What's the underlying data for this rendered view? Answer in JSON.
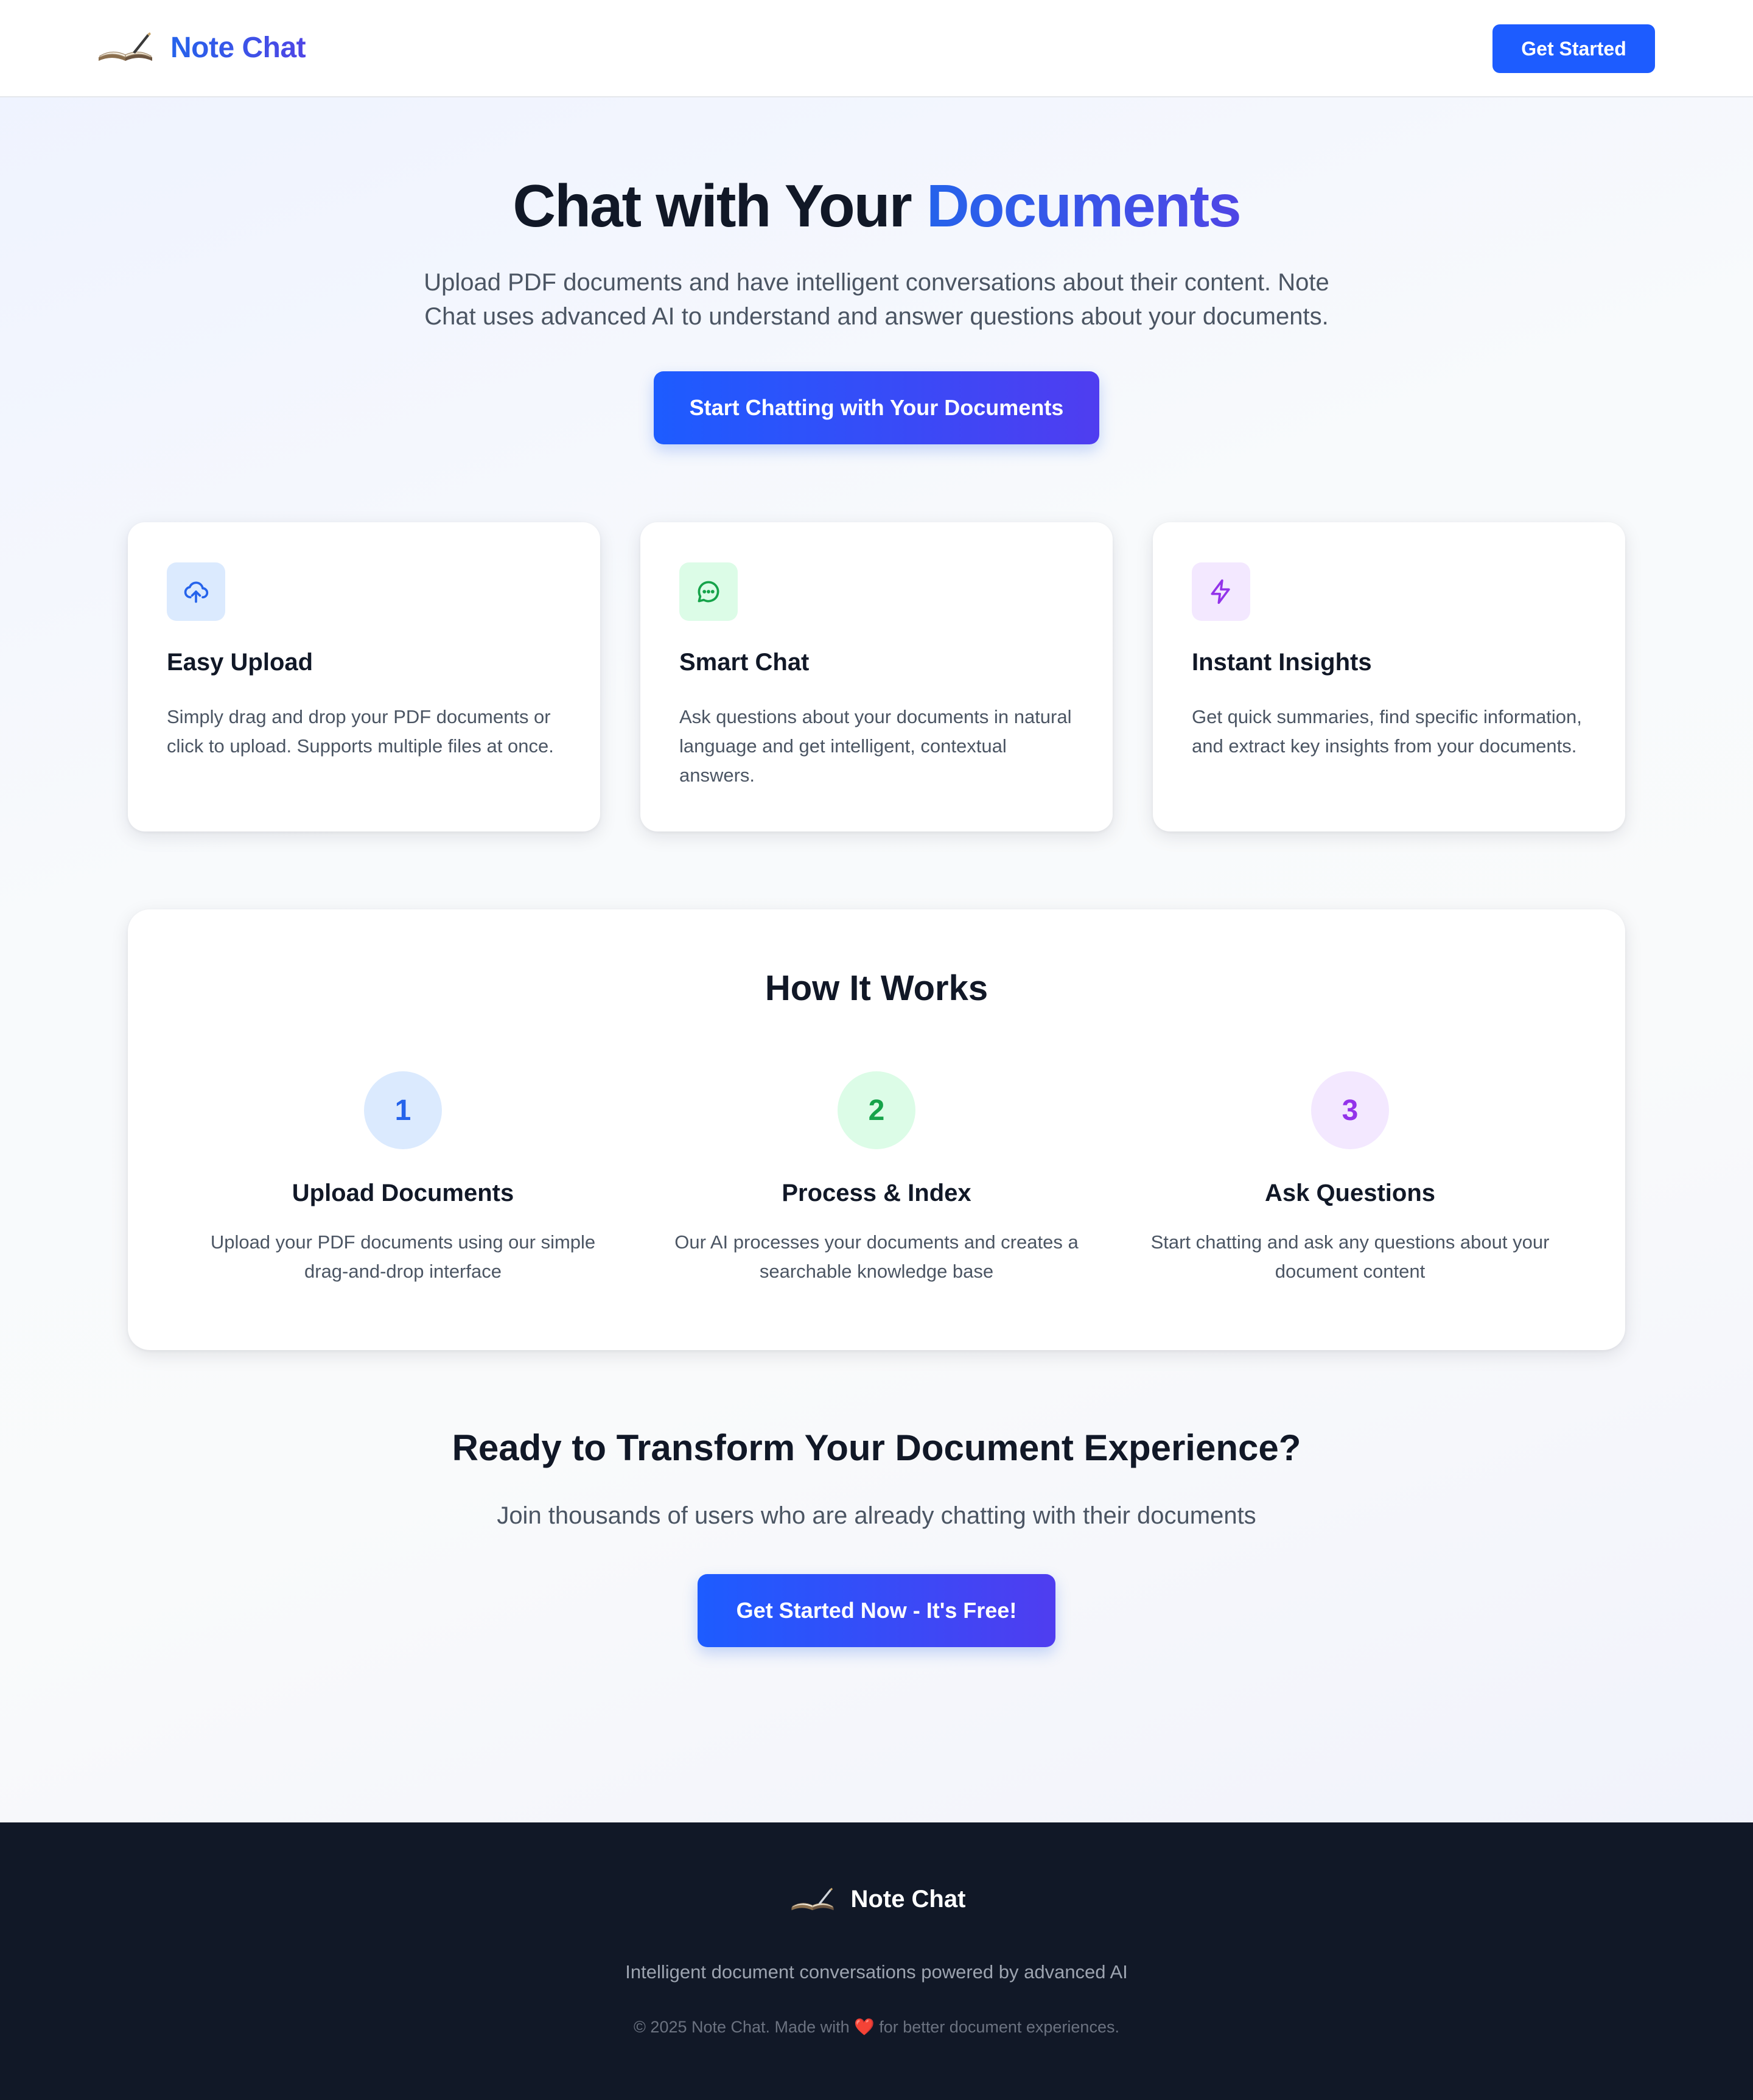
{
  "header": {
    "app_name": "Note Chat",
    "cta_label": "Get Started"
  },
  "hero": {
    "title_prefix": "Chat with Your ",
    "title_accent": "Documents",
    "subtitle": "Upload PDF documents and have intelligent conversations about their content. Note Chat uses advanced AI to understand and answer questions about your documents.",
    "cta_label": "Start Chatting with Your Documents"
  },
  "features": [
    {
      "icon": "upload-cloud-icon",
      "title": "Easy Upload",
      "description": "Simply drag and drop your PDF documents or click to upload. Supports multiple files at once."
    },
    {
      "icon": "chat-bubble-icon",
      "title": "Smart Chat",
      "description": "Ask questions about your documents in natural language and get intelligent, contextual answers."
    },
    {
      "icon": "lightning-icon",
      "title": "Instant Insights",
      "description": "Get quick summaries, find specific information, and extract key insights from your documents."
    }
  ],
  "how_it_works": {
    "title": "How It Works",
    "steps": [
      {
        "number": "1",
        "title": "Upload Documents",
        "description": "Upload your PDF documents using our simple drag-and-drop interface"
      },
      {
        "number": "2",
        "title": "Process & Index",
        "description": "Our AI processes your documents and creates a searchable knowledge base"
      },
      {
        "number": "3",
        "title": "Ask Questions",
        "description": "Start chatting and ask any questions about your document content"
      }
    ]
  },
  "ready": {
    "title": "Ready to Transform Your Document Experience?",
    "subtitle": "Join thousands of users who are already chatting with their documents",
    "cta_label": "Get Started Now - It's Free!"
  },
  "footer": {
    "app_name": "Note Chat",
    "tagline": "Intelligent document conversations powered by advanced AI",
    "copyright_prefix": "© 2025 Note Chat. Made with ",
    "heart": "❤️",
    "copyright_suffix": " for better document experiences."
  },
  "colors": {
    "primary": "#1d5cff",
    "accent_indigo": "#4f46e5",
    "blue_tint": "#dbeafe",
    "green_tint": "#dcfce7",
    "purple_tint": "#f3e8ff",
    "footer_bg": "#111827"
  }
}
